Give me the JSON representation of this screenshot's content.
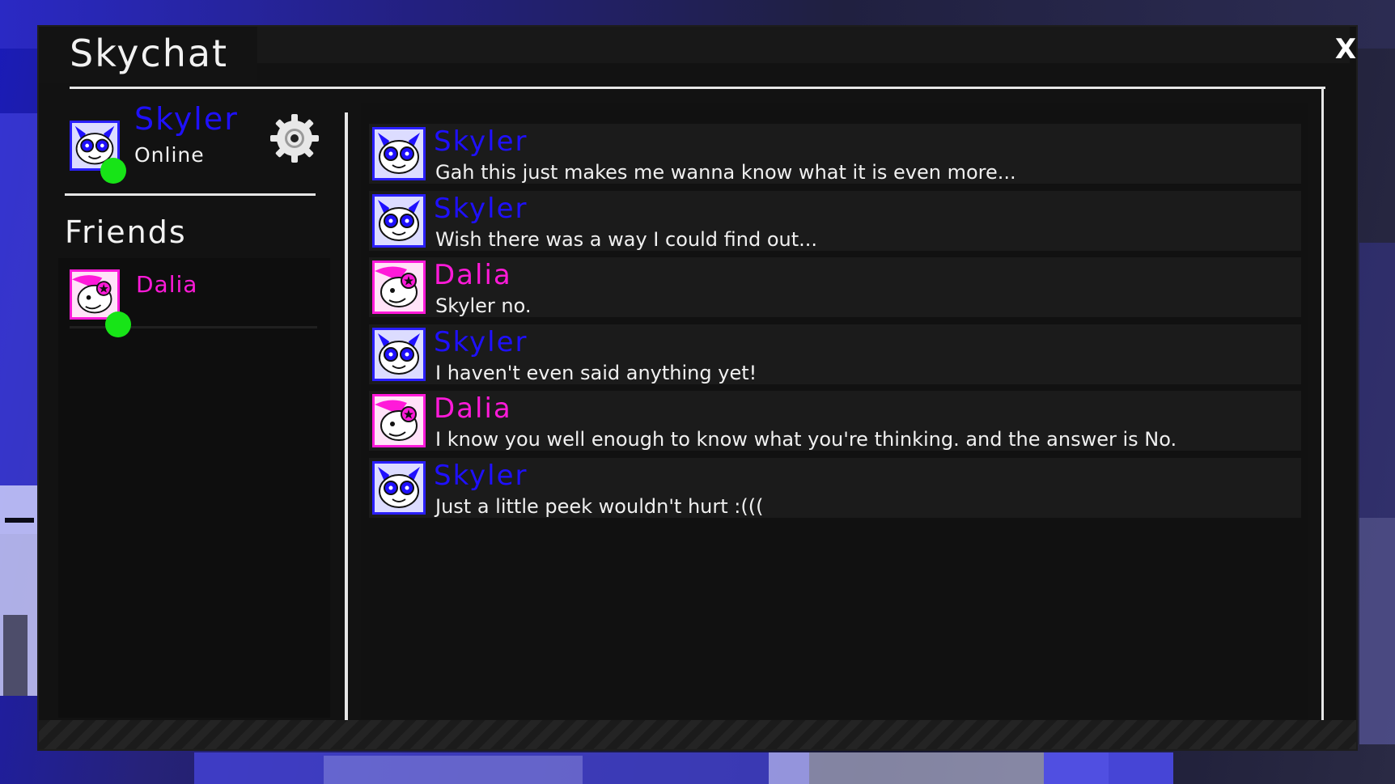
{
  "window": {
    "title": "Skychat",
    "close_label": "X"
  },
  "profile": {
    "name": "Skyler",
    "status": "Online",
    "name_color": "#1f10ff",
    "status_color": "#17e417"
  },
  "friends": {
    "heading": "Friends",
    "items": [
      {
        "name": "Dalia",
        "online": true,
        "color": "#ff1ad9"
      }
    ]
  },
  "messages": [
    {
      "author": "Skyler",
      "text": "Gah this just makes me wanna know what it is even more...",
      "color": "blue"
    },
    {
      "author": "Skyler",
      "text": "Wish there was a way I could find out...",
      "color": "blue"
    },
    {
      "author": "Dalia",
      "text": "Skyler no.",
      "color": "pink"
    },
    {
      "author": "Skyler",
      "text": "I haven't even said anything yet!",
      "color": "blue"
    },
    {
      "author": "Dalia",
      "text": "I know you well enough to know what you're thinking. and the answer is No.",
      "color": "pink"
    },
    {
      "author": "Skyler",
      "text": "Just a little peek wouldn't hurt :(((",
      "color": "blue"
    }
  ],
  "icons": {
    "close": "close-icon",
    "settings": "gear-icon",
    "online": "status-online-dot"
  }
}
